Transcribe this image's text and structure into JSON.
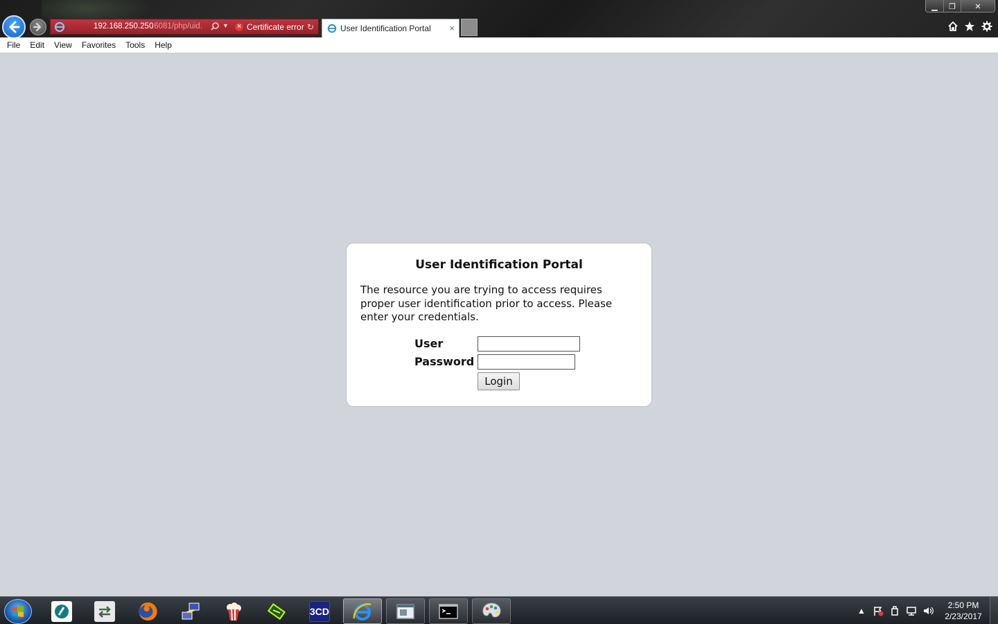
{
  "browser": {
    "address": {
      "url_host": "192.168.250.250",
      "url_rest": ":6081/php/uid.",
      "cert_error": "Certificate error"
    },
    "tab": {
      "title": "User Identification Portal",
      "close": "×"
    },
    "window_controls": {
      "minimize": "▁",
      "maximize": "❐",
      "close": "✕"
    }
  },
  "menu": {
    "items": [
      "File",
      "Edit",
      "View",
      "Favorites",
      "Tools",
      "Help"
    ]
  },
  "portal": {
    "title": "User Identification Portal",
    "description": "The resource you are trying to access requires proper user identification prior to access. Please enter your credentials.",
    "user_label": "User",
    "password_label": "Password",
    "user_value": "",
    "password_value": "",
    "login_label": "Login"
  },
  "taskbar": {
    "apps": [
      "start",
      "app-n",
      "transfer",
      "firefox",
      "network-tool",
      "popcorn-time",
      "ftp-client",
      "3cd",
      "internet-explorer",
      "app-window",
      "command-prompt",
      "paint"
    ],
    "app_3cd_label": "3CD",
    "clock": {
      "time": "2:50 PM",
      "date": "2/23/2017"
    }
  },
  "colors": {
    "page_bg": "#d1d5db",
    "address_error": "#c0343d",
    "accent_blue": "#1e88e5"
  }
}
